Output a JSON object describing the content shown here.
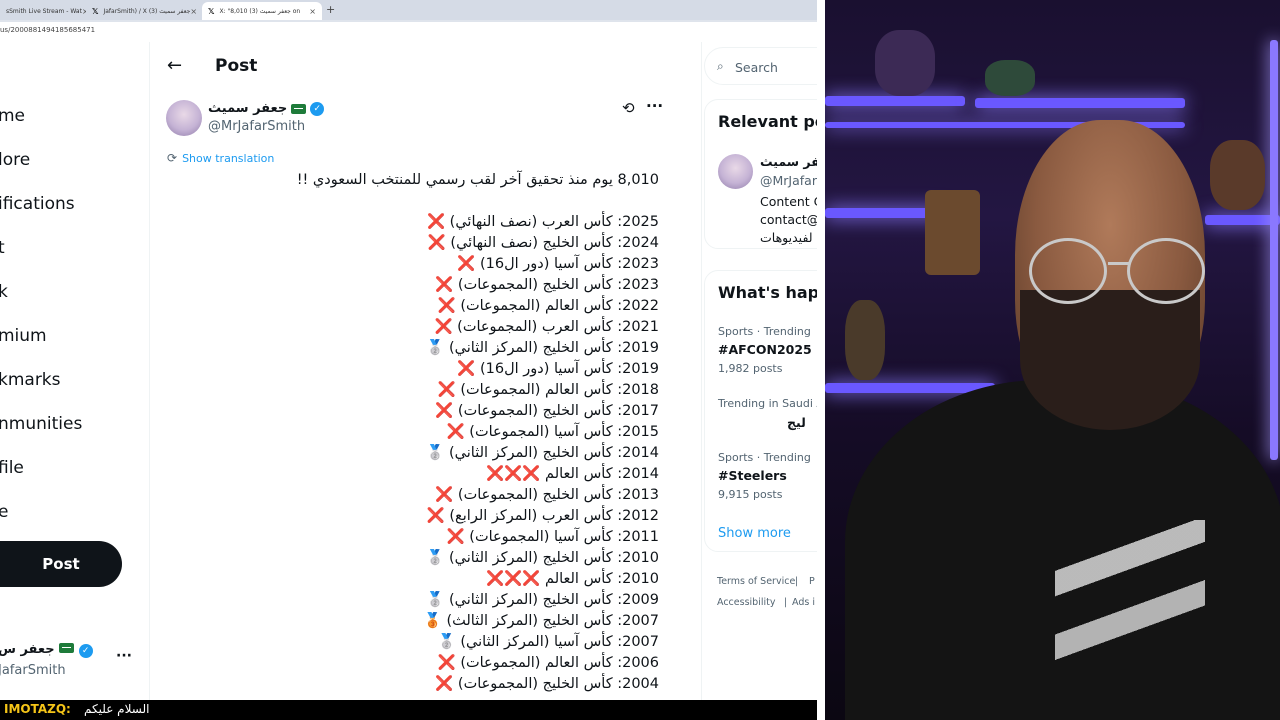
{
  "browser": {
    "tabs": [
      {
        "label": "sSmith Live Stream - Wat",
        "icon": "youtube-icon",
        "active": false
      },
      {
        "label": "JafarSmith) / X جعفر سميث (3)",
        "icon": "x-logo-icon",
        "active": false
      },
      {
        "label": "X: \"8,010 جعفر سميث (3) on",
        "icon": "x-logo-icon",
        "active": true
      }
    ],
    "new_tab": "+",
    "url": "us/2000881494185685471"
  },
  "nav": {
    "items": [
      "me",
      "lore",
      "ifications",
      "t",
      "k",
      "mium",
      "kmarks",
      "nmunities",
      "file",
      "e"
    ],
    "post_button": "Post",
    "account_name": "جعفر س",
    "account_handle": "JafarSmith",
    "account_more": "···"
  },
  "post": {
    "back": "←",
    "title": "Post",
    "author_name": "جعفر سميث",
    "author_handle": "@MrJafarSmith",
    "more": "···",
    "show_translation": "Show translation",
    "lines": [
      "8,010 يوم منذ تحقيق آخر لقب رسمي للمنتخب السعودي !!",
      "",
      "2025: كأس العرب (نصف النهائي) ❌",
      "2024: كأس الخليج (نصف النهائي) ❌",
      "2023: كأس آسيا (دور ال16) ❌",
      "2023: كأس الخليج (المجموعات) ❌",
      "2022: كأس العالم (المجموعات) ❌",
      "2021: كأس العرب (المجموعات) ❌",
      "2019: كأس الخليج (المركز الثاني) 🥈",
      "2019: كأس آسيا (دور ال16) ❌",
      "2018: كأس العالم (المجموعات) ❌",
      "2017: كأس الخليج (المجموعات) ❌",
      "2015: كأس آسيا (المجموعات) ❌",
      "2014: كأس الخليج (المركز الثاني) 🥈",
      "2014: كأس العالم ❌❌❌",
      "2013: كأس الخليج (المجموعات) ❌",
      "2012: كأس العرب (المركز الرابع) ❌",
      "2011: كأس آسيا (المجموعات) ❌",
      "2010: كأس الخليج (المركز الثاني) 🥈",
      "2010: كأس العالم ❌❌❌",
      "2009: كأس الخليج (المركز الثاني) 🥈",
      "2007: كأس الخليج (المركز الثالث) 🥉",
      "2007: كأس آسيا (المركز الثاني) 🥈",
      "2006: كأس العالم (المجموعات) ❌",
      "2004: كأس الخليج (المجموعات) ❌"
    ]
  },
  "sidebar": {
    "search_placeholder": "Search",
    "relevant_title": "Relevant pe",
    "relevant_name": "جعفر سميث",
    "relevant_handle": "@MrJafarS",
    "relevant_bio": [
      "Content C",
      "contact@",
      "لفيديوهات"
    ],
    "trends_title": "What's happ",
    "trends": [
      {
        "meta": "Sports · Trending",
        "name": "#AFCON2025",
        "count": "1,982 posts"
      },
      {
        "meta": "Trending in Saudi A",
        "name": "ليج",
        "count": ""
      },
      {
        "meta": "Sports · Trending",
        "name": "#Steelers",
        "count": "9,915 posts"
      }
    ],
    "show_more": "Show more",
    "footer": [
      "Terms of Service",
      "|",
      "P",
      "Accessibility",
      "|",
      "Ads i"
    ]
  },
  "chat": {
    "user": "IMOTAZQ:",
    "message": "السلام عليكم"
  },
  "colors": {
    "accent": "#1d9bf0",
    "text": "#0f1419",
    "muted": "#536471",
    "shelf_glow": "#6a58ff"
  }
}
